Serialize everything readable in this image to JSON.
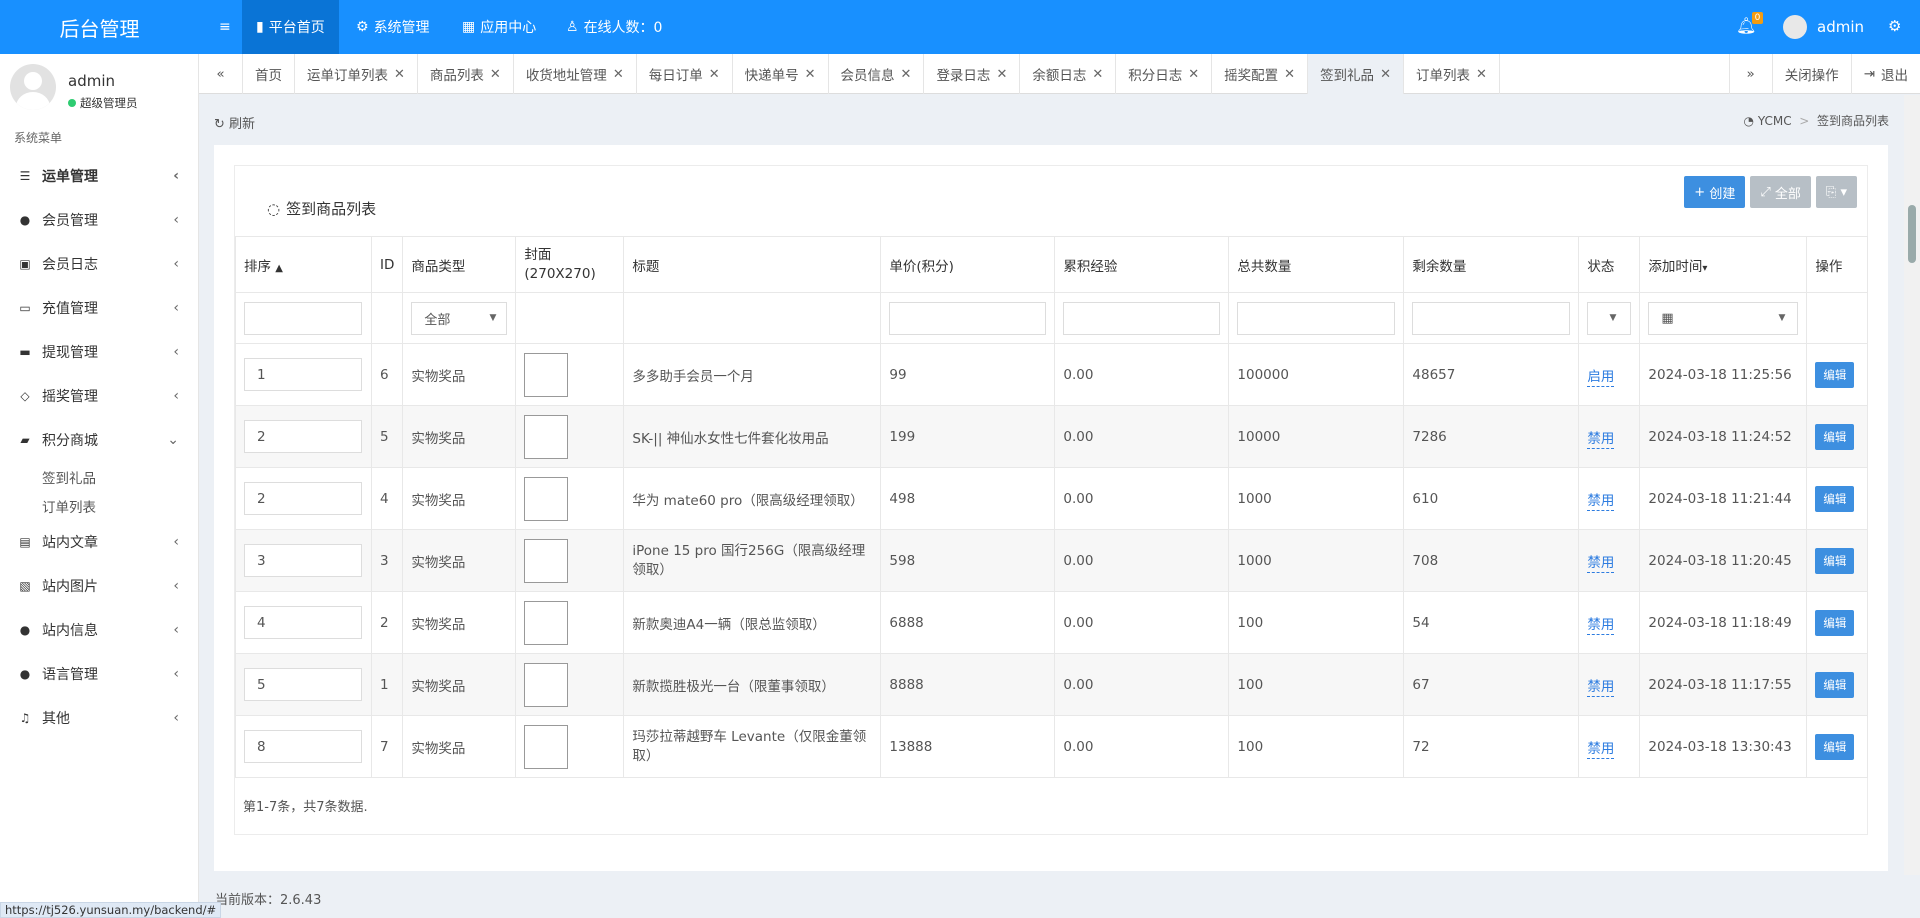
{
  "app": {
    "title": "后台管理"
  },
  "topnav": {
    "menu_icon": "hamburger-icon",
    "items": [
      {
        "label": "平台首页",
        "icon": "bookmark-icon"
      },
      {
        "label": "系统管理",
        "icon": "gears-icon"
      },
      {
        "label": "应用中心",
        "icon": "grid-icon"
      },
      {
        "label": "在线人数：0",
        "icon": "user-icon"
      }
    ],
    "bell_badge": "0",
    "username": "admin"
  },
  "tabs": {
    "prev": "«",
    "next": "»",
    "items": [
      "首页",
      "运单订单列表",
      "商品列表",
      "收货地址管理",
      "每日订单",
      "快递单号",
      "会员信息",
      "登录日志",
      "余额日志",
      "积分日志",
      "摇奖配置",
      "签到礼品",
      "订单列表"
    ],
    "close_ops": "关闭操作",
    "logout": "退出"
  },
  "sidebar": {
    "user": {
      "name": "admin",
      "role": "超级管理员"
    },
    "menu_title": "系统菜单",
    "items": [
      {
        "label": "运单管理"
      },
      {
        "label": "会员管理"
      },
      {
        "label": "会员日志"
      },
      {
        "label": "充值管理"
      },
      {
        "label": "提现管理"
      },
      {
        "label": "摇奖管理"
      },
      {
        "label": "积分商城"
      },
      {
        "label": "站内文章"
      },
      {
        "label": "站内图片"
      },
      {
        "label": "站内信息"
      },
      {
        "label": "语言管理"
      },
      {
        "label": "其他"
      }
    ],
    "subitems": [
      "签到礼品",
      "订单列表"
    ]
  },
  "content": {
    "refresh": "刷新",
    "breadcrumb": {
      "root": "YCMC",
      "sep": ">",
      "current": "签到商品列表"
    },
    "card_title": "签到商品列表",
    "buttons": {
      "create": "创建",
      "all": "全部"
    },
    "columns": [
      "排序",
      "ID",
      "商品类型",
      "封面\n(270X270)",
      "标题",
      "单价(积分)",
      "累积经验",
      "总共数量",
      "剩余数量",
      "状态",
      "添加时间",
      "操作"
    ],
    "filter_type": "全部",
    "rows": [
      {
        "sort": "1",
        "id": "6",
        "type": "实物奖品",
        "title": "多多助手会员一个月",
        "price": "99",
        "exp": "0.00",
        "total": "100000",
        "remain": "48657",
        "status": "启用",
        "time": "2024-03-18 11:25:56",
        "action": "编辑"
      },
      {
        "sort": "2",
        "id": "5",
        "type": "实物奖品",
        "title": "SK-|| 神仙水女性七件套化妆用品",
        "price": "199",
        "exp": "0.00",
        "total": "10000",
        "remain": "7286",
        "status": "禁用",
        "time": "2024-03-18 11:24:52",
        "action": "编辑"
      },
      {
        "sort": "2",
        "id": "4",
        "type": "实物奖品",
        "title": "华为 mate60 pro（限高级经理领取）",
        "price": "498",
        "exp": "0.00",
        "total": "1000",
        "remain": "610",
        "status": "禁用",
        "time": "2024-03-18 11:21:44",
        "action": "编辑"
      },
      {
        "sort": "3",
        "id": "3",
        "type": "实物奖品",
        "title": "iPone 15 pro 国行256G（限高级经理领取）",
        "price": "598",
        "exp": "0.00",
        "total": "1000",
        "remain": "708",
        "status": "禁用",
        "time": "2024-03-18 11:20:45",
        "action": "编辑"
      },
      {
        "sort": "4",
        "id": "2",
        "type": "实物奖品",
        "title": "新款奥迪A4一辆（限总监领取）",
        "price": "6888",
        "exp": "0.00",
        "total": "100",
        "remain": "54",
        "status": "禁用",
        "time": "2024-03-18 11:18:49",
        "action": "编辑"
      },
      {
        "sort": "5",
        "id": "1",
        "type": "实物奖品",
        "title": "新款揽胜极光一台（限董事领取）",
        "price": "8888",
        "exp": "0.00",
        "total": "100",
        "remain": "67",
        "status": "禁用",
        "time": "2024-03-18 11:17:55",
        "action": "编辑"
      },
      {
        "sort": "8",
        "id": "7",
        "type": "实物奖品",
        "title": "玛莎拉蒂越野车 Levante（仅限金董领取）",
        "price": "13888",
        "exp": "0.00",
        "total": "100",
        "remain": "72",
        "status": "禁用",
        "time": "2024-03-18 13:30:43",
        "action": "编辑"
      }
    ],
    "summary": "第1-7条，共7条数据.",
    "version": "当前版本：2.6.43"
  },
  "statusbar": {
    "url": "https://tj526.yunsuan.my/backend/#"
  },
  "colors": {
    "primary": "#1890ff",
    "button": "#3d8fe0",
    "bg": "#ecf0f5"
  }
}
